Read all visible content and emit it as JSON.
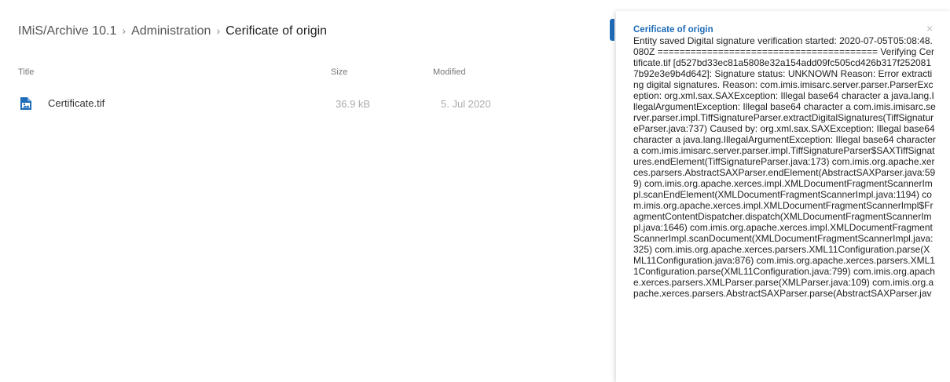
{
  "breadcrumb": {
    "items": [
      "IMiS/Archive 10.1",
      "Administration",
      "Cerificate of origin"
    ],
    "separator": "›"
  },
  "table": {
    "columns": [
      "Title",
      "Size",
      "Modified"
    ],
    "rows": [
      {
        "icon": "image-file-icon",
        "title": "Certificate.tif",
        "size": "36.9 kB",
        "modified": "5. Jul 2020"
      }
    ]
  },
  "notification": {
    "title": "Cerificate of origin",
    "close_label": "×",
    "message": "Entity saved Digital signature verification started: 2020-07-05T05:08:48.080Z ======================================== Verifying Certificate.tif [d527bd33ec81a5808e32a154add09fc505cd426b317f2520817b92e3e9b4d642]: Signature status: UNKNOWN Reason: Error extracting digital signatures. Reason: com.imis.imisarc.server.parser.ParserException: org.xml.sax.SAXException: Illegal base64 character a java.lang.IllegalArgumentException: Illegal base64 character a com.imis.imisarc.server.parser.impl.TiffSignatureParser.extractDigitalSignatures(TiffSignatureParser.java:737) Caused by: org.xml.sax.SAXException: Illegal base64 character a java.lang.IllegalArgumentException: Illegal base64 character a com.imis.imisarc.server.parser.impl.TiffSignatureParser$SAXTiffSignatures.endElement(TiffSignatureParser.java:173) com.imis.org.apache.xerces.parsers.AbstractSAXParser.endElement(AbstractSAXParser.java:599) com.imis.org.apache.xerces.impl.XMLDocumentFragmentScannerImpl.scanEndElement(XMLDocumentFragmentScannerImpl.java:1194) com.imis.org.apache.xerces.impl.XMLDocumentFragmentScannerImpl$FragmentContentDispatcher.dispatch(XMLDocumentFragmentScannerImpl.java:1646) com.imis.org.apache.xerces.impl.XMLDocumentFragmentScannerImpl.scanDocument(XMLDocumentFragmentScannerImpl.java:325) com.imis.org.apache.xerces.parsers.XML11Configuration.parse(XML11Configuration.java:876) com.imis.org.apache.xerces.parsers.XML11Configuration.parse(XML11Configuration.java:799) com.imis.org.apache.xerces.parsers.XMLParser.parse(XMLParser.java:109) com.imis.org.apache.xerces.parsers.AbstractSAXParser.parse(AbstractSAXParser.jav"
  },
  "colors": {
    "accent": "#1e6bb8",
    "muted_text": "#aaaaaa"
  }
}
